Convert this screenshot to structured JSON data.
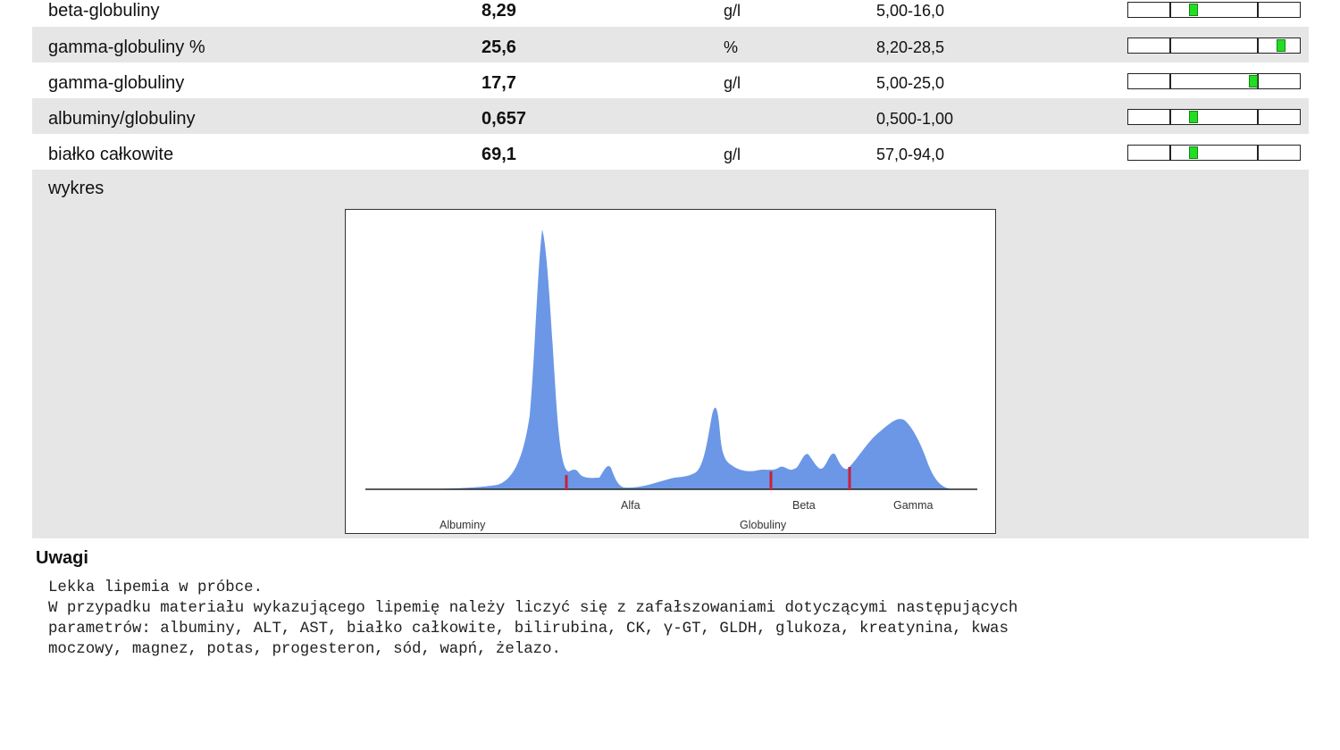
{
  "results": [
    {
      "name": "beta-globuliny",
      "value": "8,29",
      "unit": "g/l",
      "range": "5,00-16,0",
      "level": 0.38
    },
    {
      "name": "gamma-globuliny %",
      "value": "25,6",
      "unit": "%",
      "range": "8,20-28,5",
      "level": 0.89
    },
    {
      "name": "gamma-globuliny",
      "value": "17,7",
      "unit": "g/l",
      "range": "5,00-25,0",
      "level": 0.73
    },
    {
      "name": "albuminy/globuliny",
      "value": "0,657",
      "unit": "",
      "range": "0,500-1,00",
      "level": 0.38
    },
    {
      "name": "białko całkowite",
      "value": "69,1",
      "unit": "g/l",
      "range": "57,0-94,0",
      "level": 0.38
    }
  ],
  "chart": {
    "title": "wykres",
    "fill_color": "#6b97e6",
    "marker_color": "#c8203c",
    "labels_top": [
      "Alfa",
      "Beta",
      "Gamma"
    ],
    "labels_bottom": [
      "Albuminy",
      "Globuliny"
    ]
  },
  "remarks": {
    "title": "Uwagi",
    "lines": [
      "Lekka lipemia w próbce.",
      "W przypadku materiału wykazującego lipemię należy liczyć się z zafałszowaniami dotyczącymi następujących",
      "parametrów: albuminy, ALT, AST, białko całkowite, bilirubina, CK, γ-GT, GLDH, glukoza, kreatynina, kwas",
      "moczowy, magnez, potas, progesteron, sód, wapń, żelazo."
    ]
  }
}
